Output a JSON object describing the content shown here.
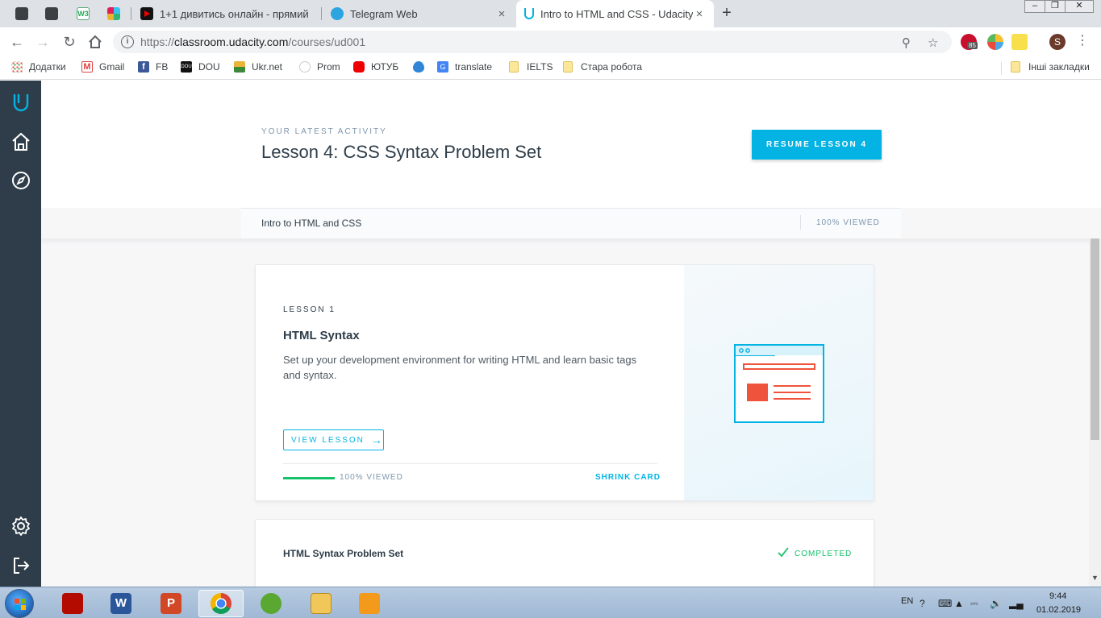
{
  "browser": {
    "tabs": [
      {
        "title": "1+1 дивитись онлайн - прямий",
        "close": "×"
      },
      {
        "title": "Telegram Web",
        "close": "×"
      },
      {
        "title": "Intro to HTML and CSS - Udacity",
        "close": "×",
        "active": true
      }
    ],
    "new_tab": "+",
    "url": {
      "scheme": "https://",
      "host": "classroom.udacity.com",
      "path": "/courses/ud001"
    },
    "avatar_letter": "S",
    "abp_badge": "85"
  },
  "bookmarks": [
    {
      "label": "Додатки",
      "icon": "apps-grid-icon"
    },
    {
      "label": "Gmail",
      "icon": "gmail-icon"
    },
    {
      "label": "FB",
      "icon": "facebook-icon"
    },
    {
      "label": "DOU",
      "icon": "dou-icon"
    },
    {
      "label": "Ukr.net",
      "icon": "ukrnet-icon"
    },
    {
      "label": "Prom",
      "icon": "prom-icon"
    },
    {
      "label": "ЮТУБ",
      "icon": "youtube-icon"
    },
    {
      "label": "",
      "icon": "drop-icon"
    },
    {
      "label": "translate",
      "icon": "google-translate-icon"
    },
    {
      "label": "IELTS",
      "icon": "folder-icon"
    },
    {
      "label": "Стара робота",
      "icon": "folder-icon"
    },
    {
      "label": "Інші закладки",
      "icon": "folder-icon"
    }
  ],
  "hero": {
    "eyebrow": "YOUR LATEST ACTIVITY",
    "title": "Lesson 4: CSS Syntax Problem Set",
    "resume_label": "RESUME LESSON 4"
  },
  "course_strip": {
    "course_name": "Intro to HTML and CSS",
    "viewed": "100% VIEWED"
  },
  "lesson_card": {
    "number": "LESSON 1",
    "title": "HTML Syntax",
    "description": "Set up your development environment for writing HTML and learn basic tags and syntax.",
    "view_label": "VIEW LESSON",
    "progress": 1.0,
    "viewed": "100% VIEWED",
    "shrink_label": "SHRINK CARD"
  },
  "problem_card": {
    "title": "HTML Syntax Problem Set",
    "status": "COMPLETED"
  },
  "colors": {
    "udacity_blue": "#02b3e4",
    "nav_dark": "#2e3d49",
    "success_green": "#15c26b",
    "illustration_orange": "#f0533b"
  },
  "taskbar": {
    "lang": "EN",
    "time": "9:44",
    "date": "01.02.2019",
    "apps": [
      "acrobat-icon",
      "word-icon",
      "powerpoint-icon",
      "chrome-icon",
      "utorrent-icon",
      "explorer-icon",
      "media-player-icon"
    ]
  }
}
